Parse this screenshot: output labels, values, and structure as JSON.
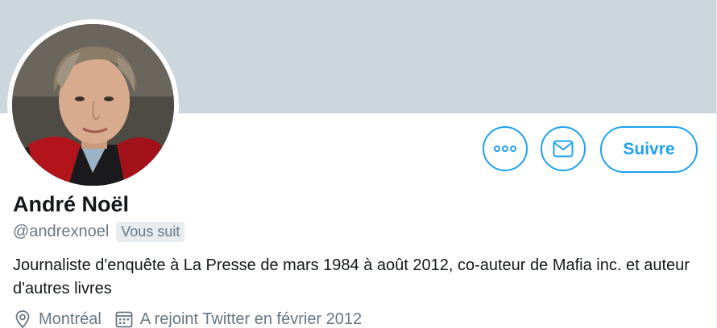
{
  "profile": {
    "display_name": "André Noël",
    "handle": "@andrexnoel",
    "follows_you_badge": "Vous suit",
    "bio": "Journaliste d'enquête à La Presse de mars 1984 à août 2012, co-auteur de Mafia inc. et auteur d'autres livres",
    "location": "Montréal",
    "joined": "A rejoint Twitter en février 2012"
  },
  "actions": {
    "follow_label": "Suivre",
    "more_icon": "more-dots-icon",
    "message_icon": "envelope-icon"
  },
  "icons": {
    "location": "location-pin-icon",
    "joined": "calendar-icon"
  },
  "colors": {
    "accent": "#1da1f2",
    "banner": "#ccd6dd",
    "secondary_text": "#657786",
    "primary_text": "#14171a",
    "badge_bg": "#e6ecf0"
  }
}
